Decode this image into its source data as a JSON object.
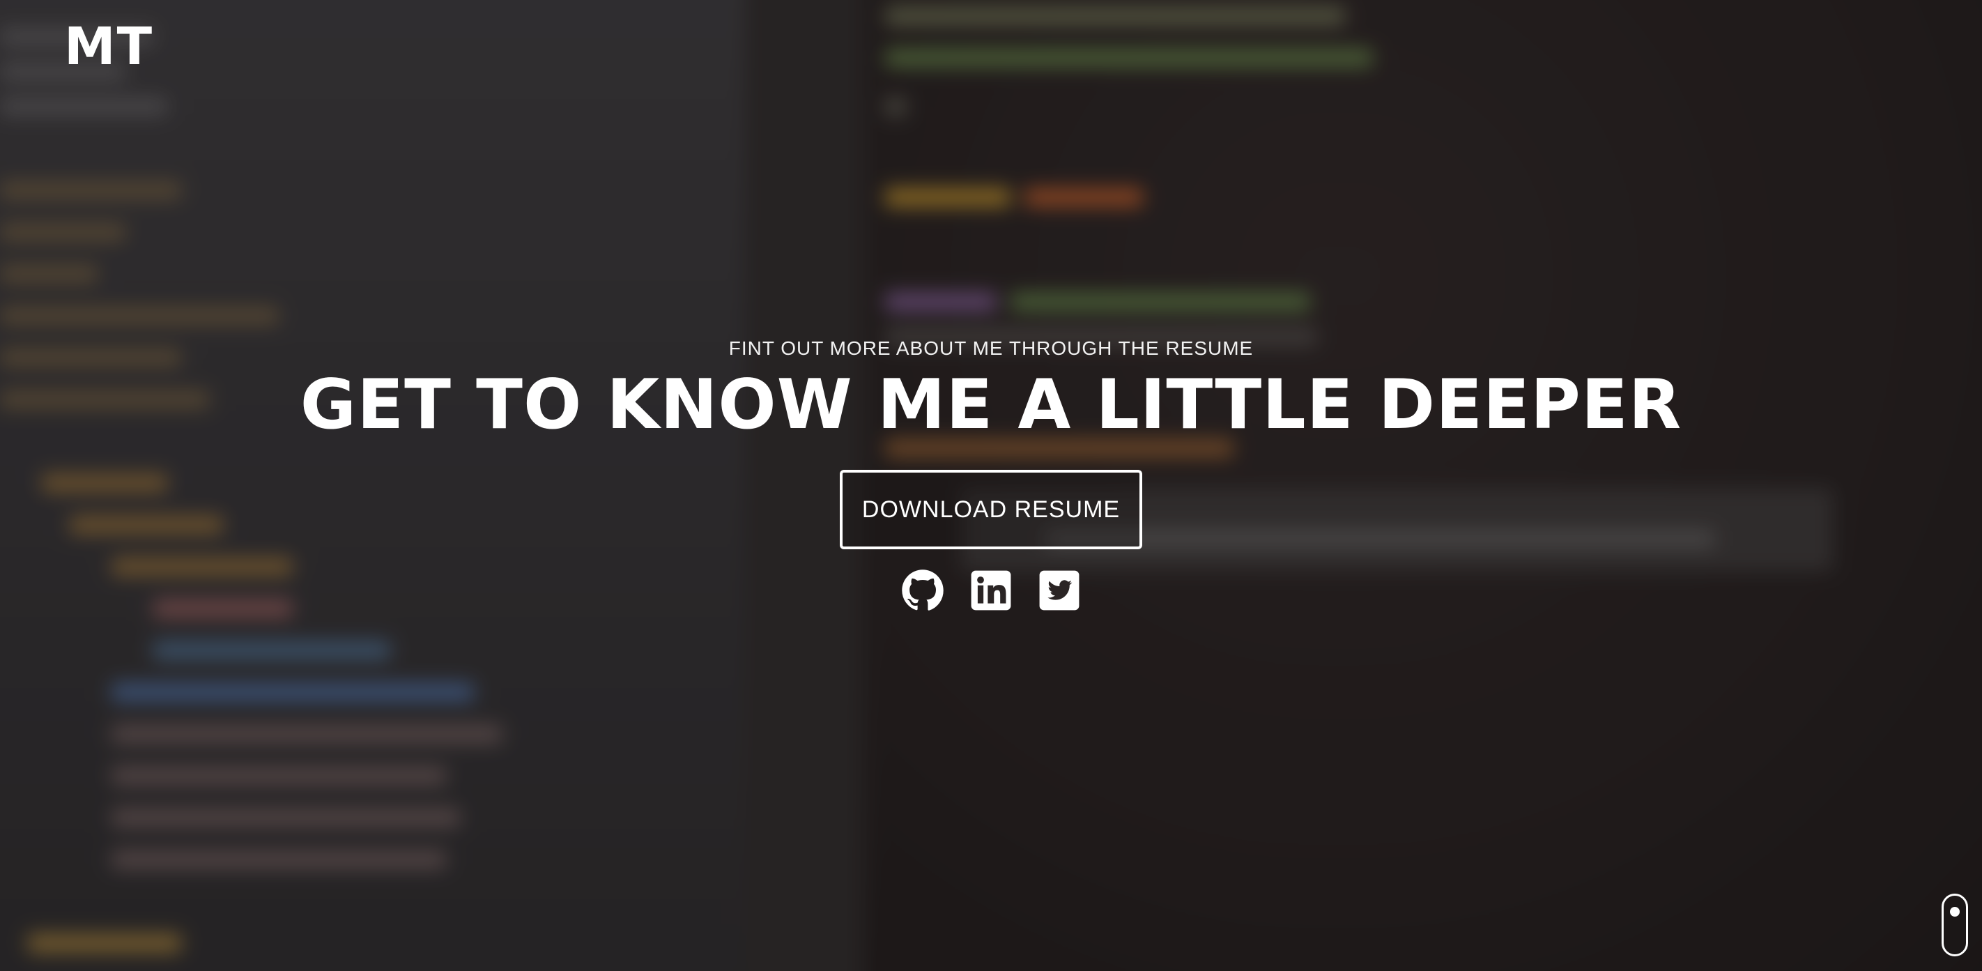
{
  "header": {
    "logo_text": "MT"
  },
  "hero": {
    "subtitle": "FINT OUT MORE ABOUT ME THROUGH THE RESUME",
    "title": "GET TO KNOW ME A LITTLE DEEPER",
    "download_button_label": "DOWNLOAD RESUME"
  },
  "socials": [
    {
      "name": "GitHub",
      "icon": "github-icon"
    },
    {
      "name": "LinkedIn",
      "icon": "linkedin-icon"
    },
    {
      "name": "Twitter",
      "icon": "twitter-icon"
    }
  ],
  "scroll_indicator": {
    "icon": "mouse-scroll-icon"
  },
  "colors": {
    "text": "#ffffff",
    "background": "#231f1f",
    "button_border": "#ffffff"
  }
}
